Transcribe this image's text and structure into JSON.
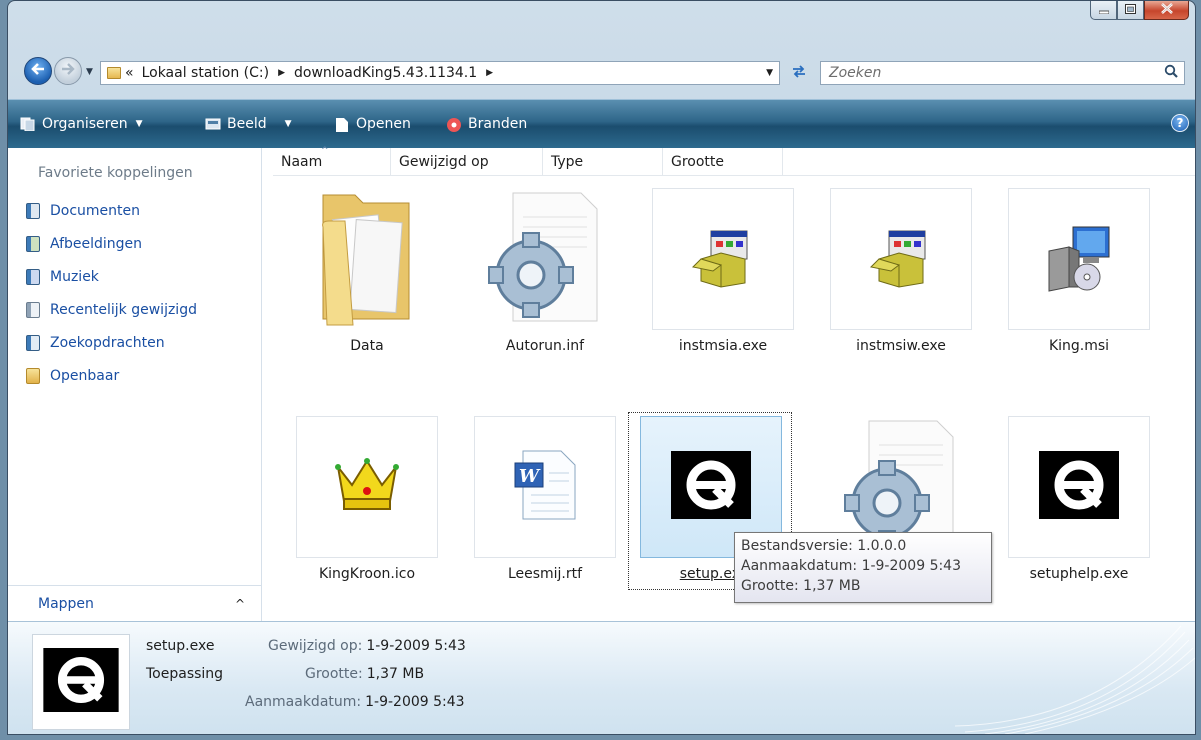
{
  "window": {
    "caption_buttons": [
      "minimize-icon",
      "maximize-icon",
      "close-icon"
    ]
  },
  "address": {
    "prefix": "«",
    "breadcrumbs": [
      "Lokaal station (C:)",
      "downloadKing5.43.1134.1"
    ],
    "search_placeholder": "Zoeken"
  },
  "toolbar": {
    "organize_label": "Organiseren",
    "view_label": "Beeld",
    "open_label": "Openen",
    "burn_label": "Branden",
    "help_symbol": "?"
  },
  "sidebar": {
    "heading": "Favoriete koppelingen",
    "items": [
      {
        "label": "Documenten",
        "icon": "documents-icon"
      },
      {
        "label": "Afbeeldingen",
        "icon": "pictures-icon"
      },
      {
        "label": "Muziek",
        "icon": "music-icon"
      },
      {
        "label": "Recentelijk gewijzigd",
        "icon": "recent-icon"
      },
      {
        "label": "Zoekopdrachten",
        "icon": "searches-icon"
      },
      {
        "label": "Openbaar",
        "icon": "public-folder-icon"
      }
    ],
    "folders_label": "Mappen",
    "folders_chevron": "^"
  },
  "columns": [
    "Naam",
    "Gewijzigd op",
    "Type",
    "Grootte"
  ],
  "sort_indicator": "^",
  "files": [
    {
      "name": "Data",
      "icon": "folder-icon"
    },
    {
      "name": "Autorun.inf",
      "icon": "settings-file-icon"
    },
    {
      "name": "instmsia.exe",
      "icon": "installer-box-icon"
    },
    {
      "name": "instmsiw.exe",
      "icon": "installer-box-icon"
    },
    {
      "name": "King.msi",
      "icon": "msi-package-icon"
    },
    {
      "name": "KingKroon.ico",
      "icon": "crown-icon"
    },
    {
      "name": "Leesmij.rtf",
      "icon": "word-document-icon"
    },
    {
      "name": "setup.exe",
      "icon": "setup-q-icon",
      "selected": true
    },
    {
      "name": "",
      "icon": "settings-file-icon"
    },
    {
      "name": "setuphelp.exe",
      "icon": "setup-q-icon"
    }
  ],
  "tooltip": {
    "line1": "Bestandsversie: 1.0.0.0",
    "line2": "Aanmaakdatum: 1-9-2009 5:43",
    "line3": "Grootte: 1,37 MB"
  },
  "details": {
    "name": "setup.exe",
    "type": "Toepassing",
    "modified_key": "Gewijzigd op:",
    "modified_val": "1-9-2009 5:43",
    "size_key": "Grootte:",
    "size_val": "1,37 MB",
    "created_key": "Aanmaakdatum:",
    "created_val": "1-9-2009 5:43"
  },
  "colors": {
    "toolbar": "#2e6588",
    "link": "#1a4fa3",
    "selection": "#cfe7f8"
  }
}
